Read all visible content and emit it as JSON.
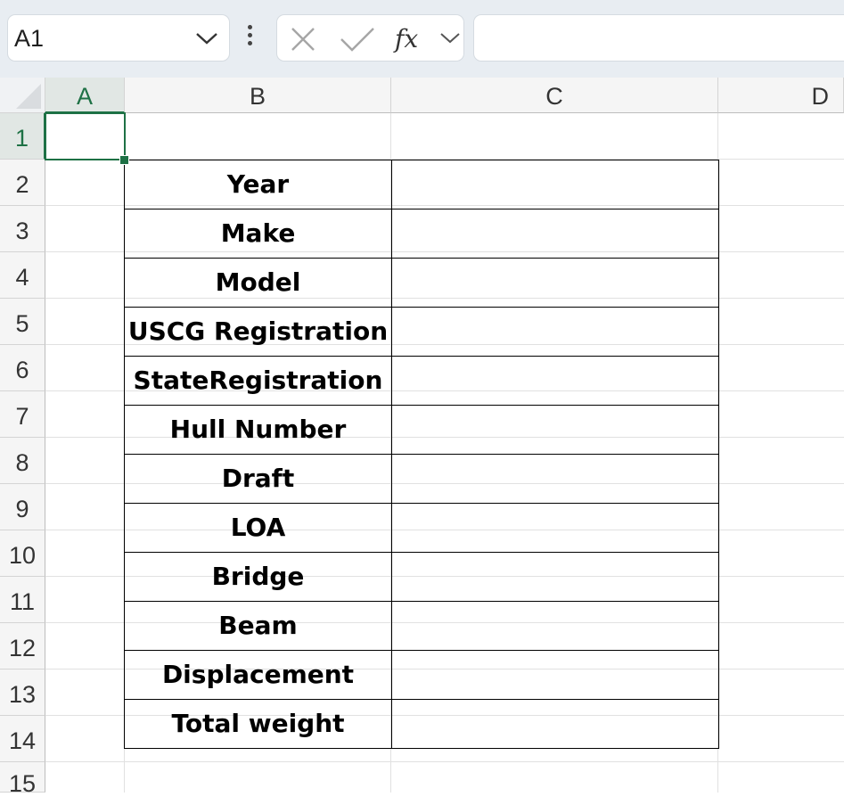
{
  "formula_bar": {
    "name_box": "A1",
    "fx_label": "fx",
    "formula_value": ""
  },
  "columns": [
    "A",
    "B",
    "C",
    "D"
  ],
  "rows": [
    "1",
    "2",
    "3",
    "4",
    "5",
    "6",
    "7",
    "8",
    "9",
    "10",
    "11",
    "12",
    "13",
    "14",
    "15"
  ],
  "selected_cell": "A1",
  "table": {
    "rows": [
      {
        "label": "Year",
        "value": ""
      },
      {
        "label": "Make",
        "value": ""
      },
      {
        "label": "Model",
        "value": ""
      },
      {
        "label": "USCG Registration",
        "value": ""
      },
      {
        "label": "StateRegistration",
        "value": ""
      },
      {
        "label": "Hull Number",
        "value": ""
      },
      {
        "label": "Draft",
        "value": ""
      },
      {
        "label": "LOA",
        "value": ""
      },
      {
        "label": "Bridge",
        "value": ""
      },
      {
        "label": "Beam",
        "value": ""
      },
      {
        "label": "Displacement",
        "value": ""
      },
      {
        "label": "Total weight",
        "value": ""
      }
    ]
  },
  "colors": {
    "accent": "#1e7145",
    "header_bg": "#f5f5f5",
    "toolbar_bg": "#e8edf2"
  },
  "icons": [
    "chevron-down-icon",
    "more-vertical-icon",
    "cancel-icon",
    "enter-check-icon",
    "insert-function-icon"
  ]
}
